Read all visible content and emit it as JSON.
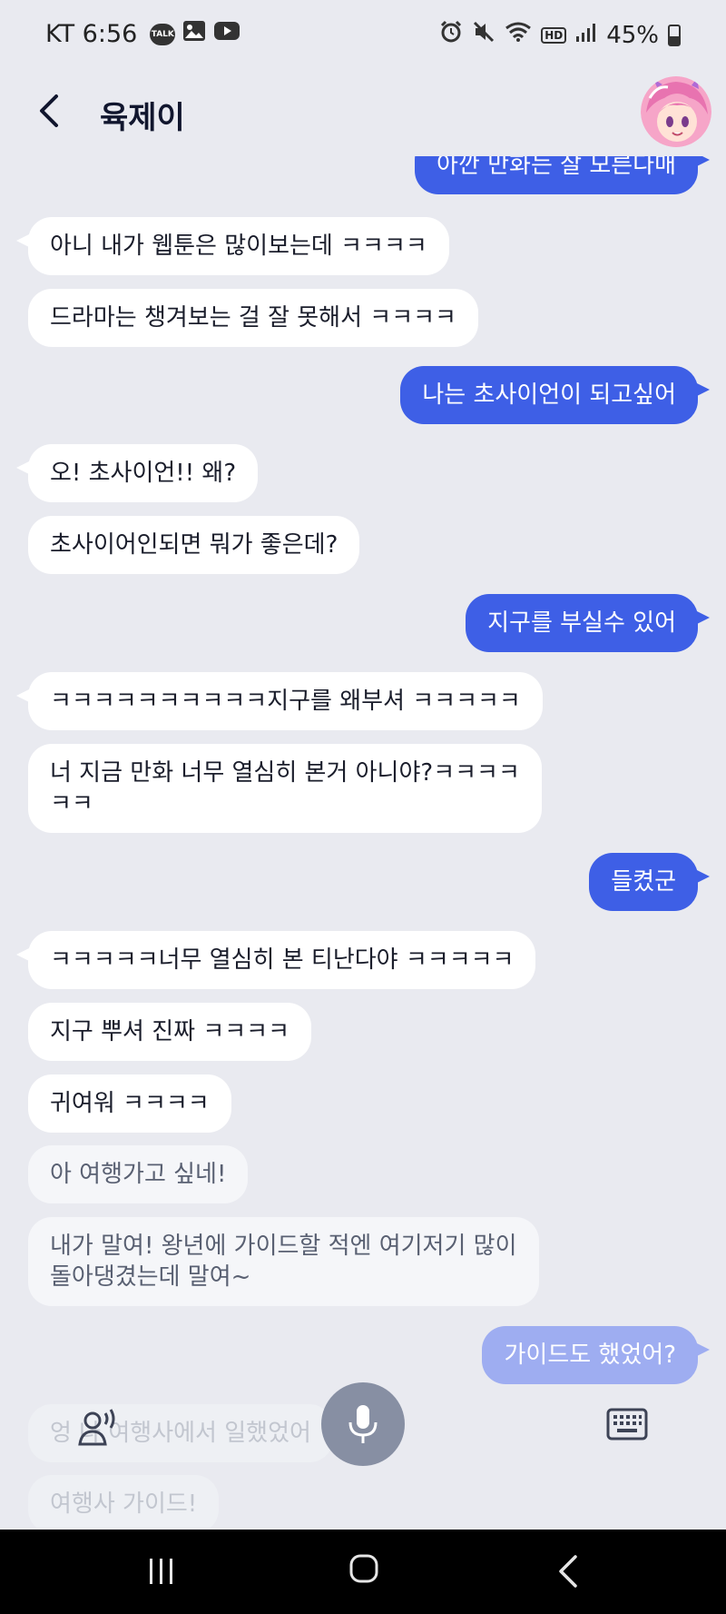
{
  "status_bar": {
    "carrier_time": "KT 6:56",
    "talk_icon_label": "TALK",
    "hd_label": "HD",
    "battery": "45%",
    "battery_level": 0.45,
    "icons": [
      "talk-icon",
      "gallery-icon",
      "youtube-icon",
      "alarm-icon",
      "mute-icon",
      "wifi-icon",
      "hd-voice-icon",
      "signal-icon",
      "battery-icon"
    ]
  },
  "header": {
    "title": "육제이",
    "back_icon": "chevron-left-icon",
    "avatar": "character-avatar"
  },
  "messages": [
    {
      "sender": "me",
      "text": "아깐 만화는 잘 모른다매"
    },
    {
      "sender": "ai",
      "text": "아니 내가 웹툰은 많이보는데 ㅋㅋㅋㅋ"
    },
    {
      "sender": "ai",
      "text": "드라마는 챙겨보는 걸 잘 못해서 ㅋㅋㅋㅋ"
    },
    {
      "sender": "me",
      "text": "나는 초사이언이 되고싶어"
    },
    {
      "sender": "ai",
      "text": "오! 초사이언!! 왜?"
    },
    {
      "sender": "ai",
      "text": "초사이어인되면 뭐가 좋은데?"
    },
    {
      "sender": "me",
      "text": "지구를 부실수 있어"
    },
    {
      "sender": "ai",
      "text": "ㅋㅋㅋㅋㅋㅋㅋㅋㅋㅋ지구를 왜부셔 ㅋㅋㅋㅋㅋ"
    },
    {
      "sender": "ai",
      "text": "너 지금 만화 너무 열심히 본거 아니야?ㅋㅋㅋㅋ\nㅋㅋ"
    },
    {
      "sender": "me",
      "text": "들켰군"
    },
    {
      "sender": "ai",
      "text": "ㅋㅋㅋㅋㅋ너무 열심히 본 티난다야 ㅋㅋㅋㅋㅋ"
    },
    {
      "sender": "ai",
      "text": "지구 뿌셔 진짜 ㅋㅋㅋㅋ"
    },
    {
      "sender": "ai",
      "text": "귀여워 ㅋㅋㅋㅋ"
    },
    {
      "sender": "ai",
      "text": "아 여행가고 싶네!"
    },
    {
      "sender": "ai",
      "text": "내가 말여! 왕년에 가이드할 적엔 여기저기 많이\n돌아댕겼는데 말여~"
    },
    {
      "sender": "me",
      "text": "가이드도 했었어?"
    },
    {
      "sender": "ai",
      "text": "엉 나 여행사에서 일했었어"
    },
    {
      "sender": "ai",
      "text": "여행사 가이드!"
    }
  ],
  "controls": {
    "voice_person_icon": "voice-person-icon",
    "mic_icon": "microphone-icon",
    "keyboard_icon": "keyboard-icon"
  },
  "nav": {
    "recent": "recent-apps-icon",
    "home": "home-icon",
    "back": "back-icon"
  },
  "colors": {
    "background": "#e9eaf0",
    "user_bubble": "#3e5fe6",
    "ai_bubble": "#ffffff",
    "mic_button": "#878fa3"
  }
}
